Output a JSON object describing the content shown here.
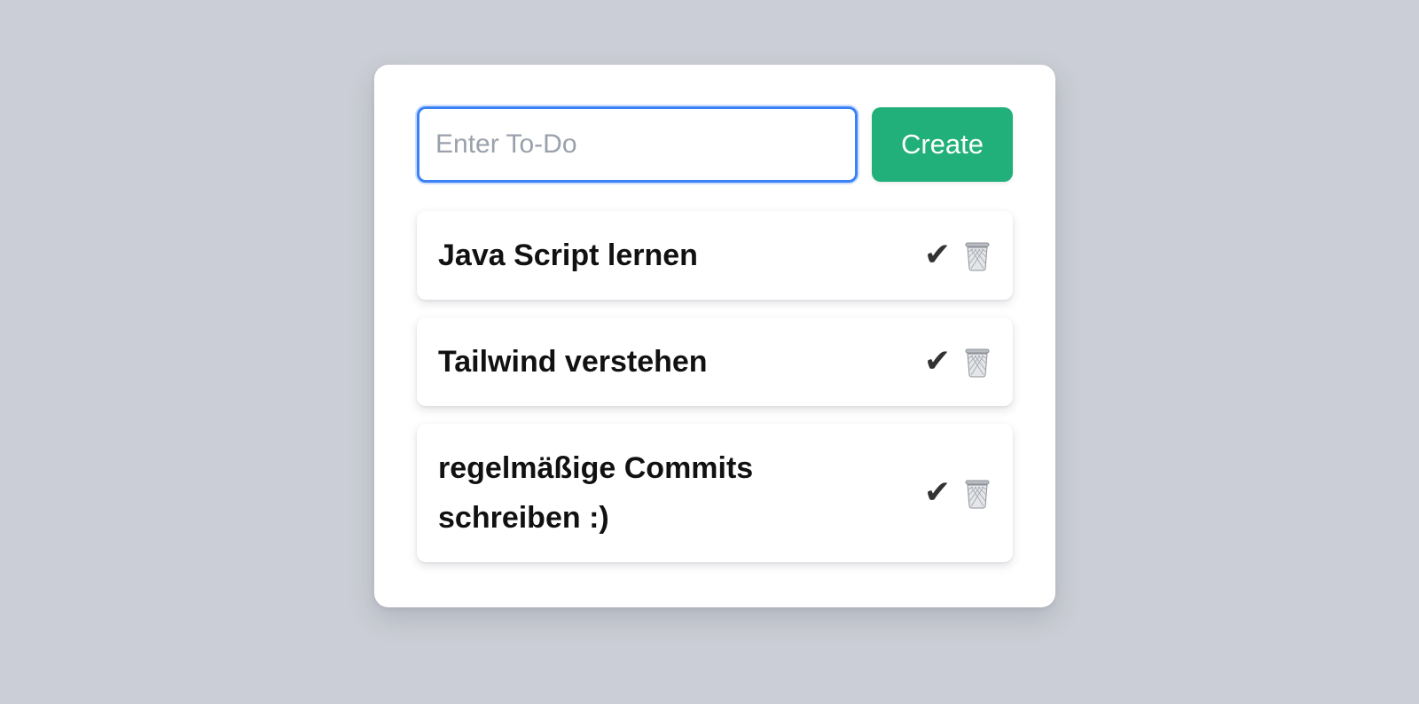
{
  "input": {
    "placeholder": "Enter To-Do",
    "value": ""
  },
  "create_button": {
    "label": "Create",
    "color": "#22b07a"
  },
  "accent_color": "#3b82f6",
  "todos": [
    {
      "text": "Java Script lernen",
      "check_icon": "check-icon",
      "delete_icon": "trash-icon"
    },
    {
      "text": "Tailwind verstehen",
      "check_icon": "check-icon",
      "delete_icon": "trash-icon"
    },
    {
      "text": "regelmäßige Commits schreiben :)",
      "check_icon": "check-icon",
      "delete_icon": "trash-icon"
    }
  ],
  "icons": {
    "check": "✔"
  }
}
